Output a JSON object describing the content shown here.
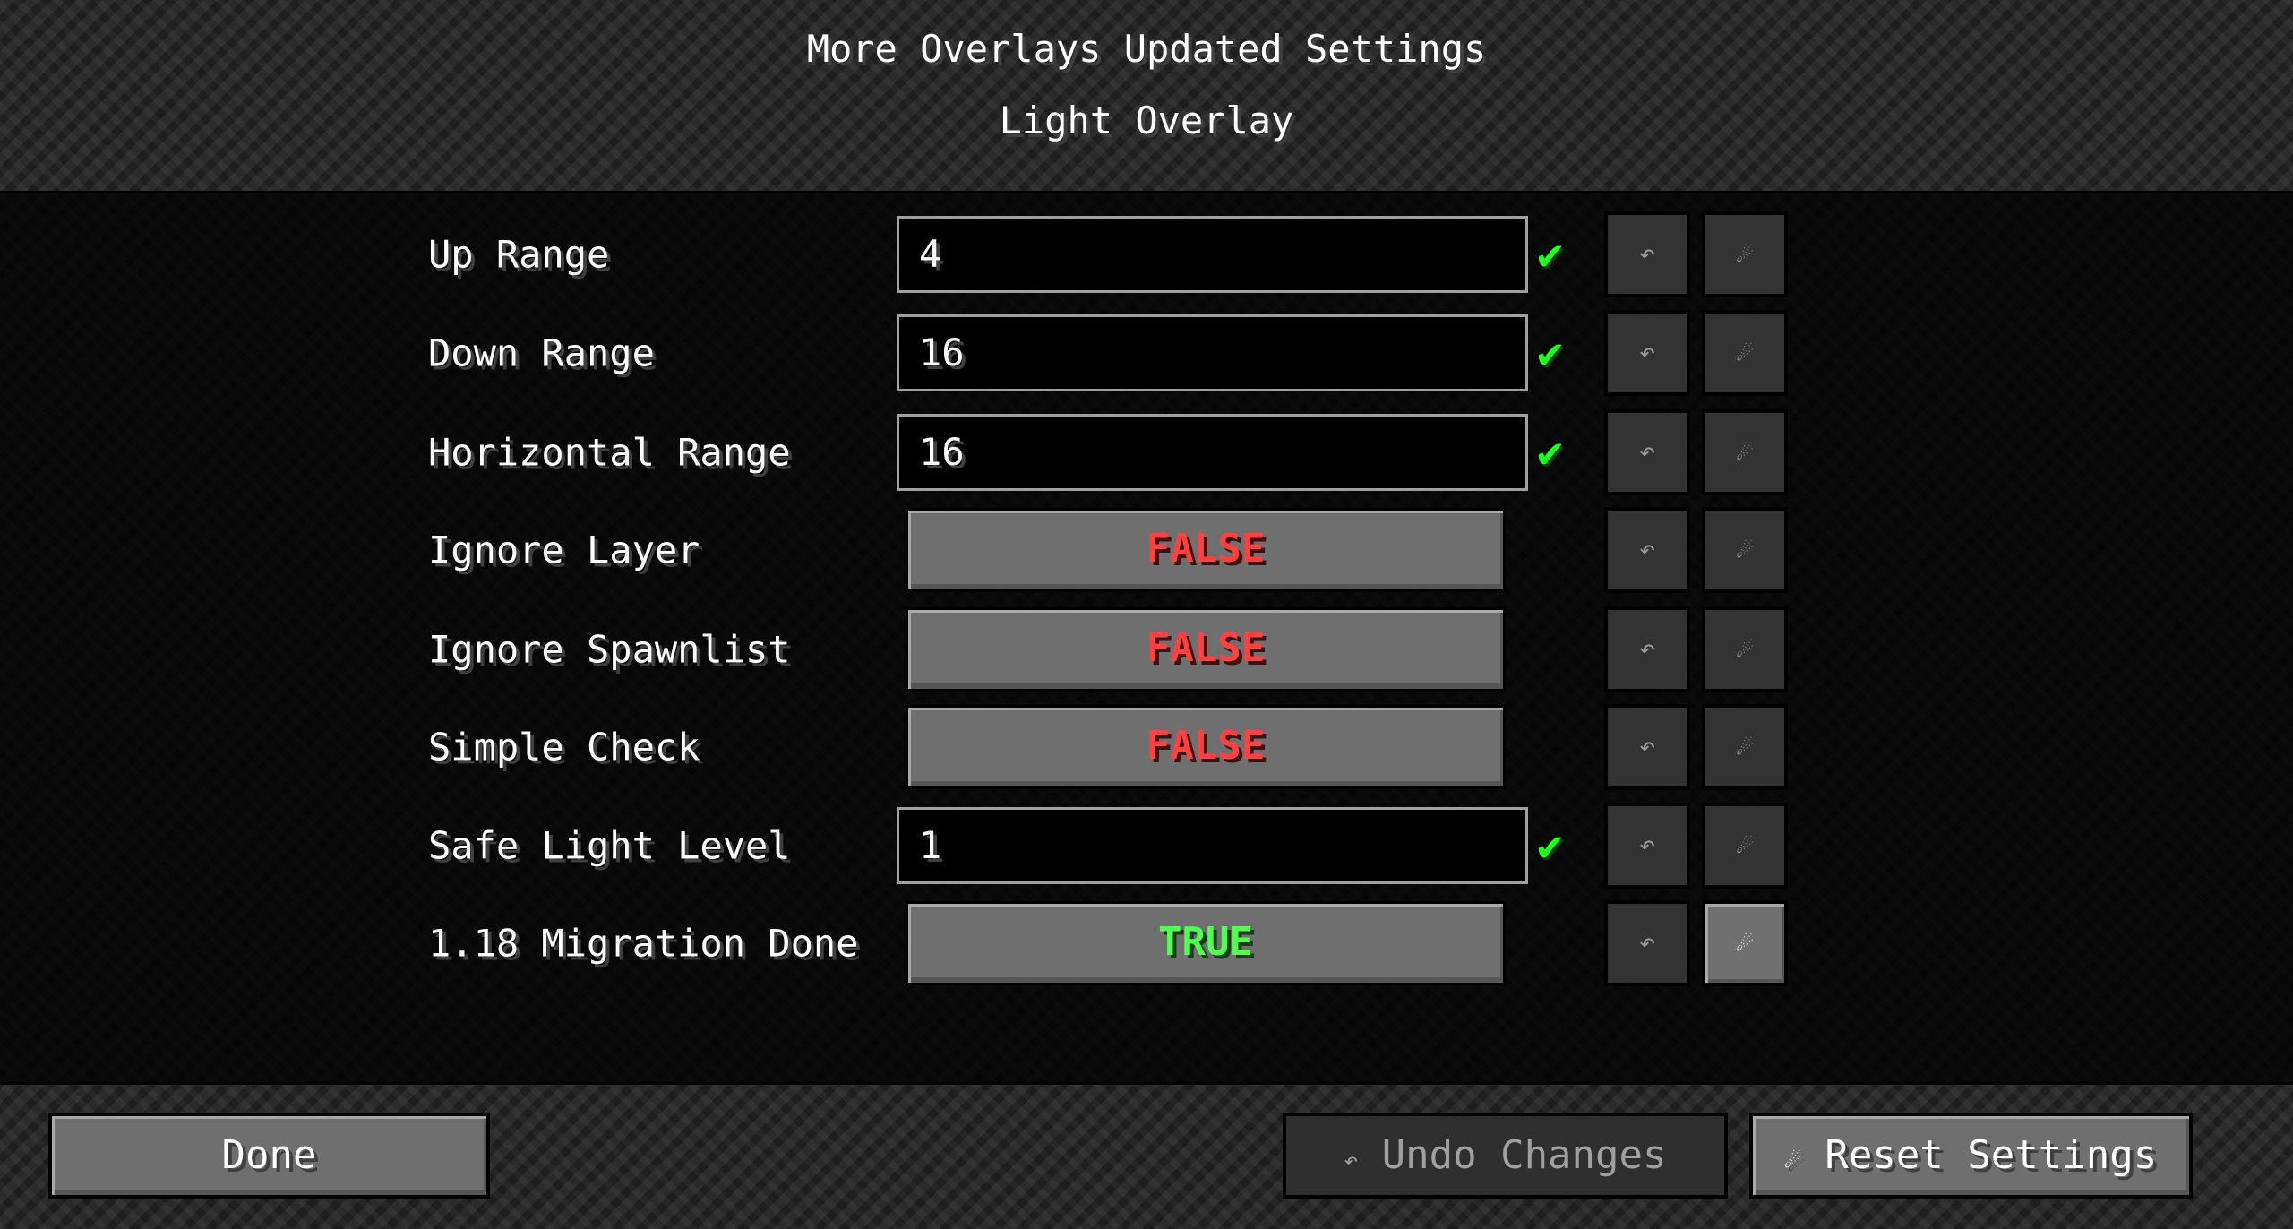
{
  "header": {
    "title": "More Overlays Updated Settings",
    "subtitle": "Light Overlay"
  },
  "rows": [
    {
      "label": "Up Range",
      "type": "text",
      "value": "4",
      "valid": true
    },
    {
      "label": "Down Range",
      "type": "text",
      "value": "16",
      "valid": true
    },
    {
      "label": "Horizontal Range",
      "type": "text",
      "value": "16",
      "valid": true
    },
    {
      "label": "Ignore Layer",
      "type": "toggle",
      "value": "FALSE"
    },
    {
      "label": "Ignore Spawnlist",
      "type": "toggle",
      "value": "FALSE"
    },
    {
      "label": "Simple Check",
      "type": "toggle",
      "value": "FALSE"
    },
    {
      "label": "Safe Light Level",
      "type": "text",
      "value": "1",
      "valid": true
    },
    {
      "label": "1.18 Migration Done",
      "type": "toggle",
      "value": "TRUE"
    }
  ],
  "icons": {
    "valid": "✔",
    "undo": "↶",
    "reset": "☄"
  },
  "colors": {
    "false": "#ff4040",
    "true": "#50ff50",
    "check": "#1fff1f"
  },
  "footer": {
    "done": "Done",
    "undo_icon": "↶",
    "undo": "Undo Changes",
    "reset_icon": "☄",
    "reset": "Reset Settings"
  }
}
